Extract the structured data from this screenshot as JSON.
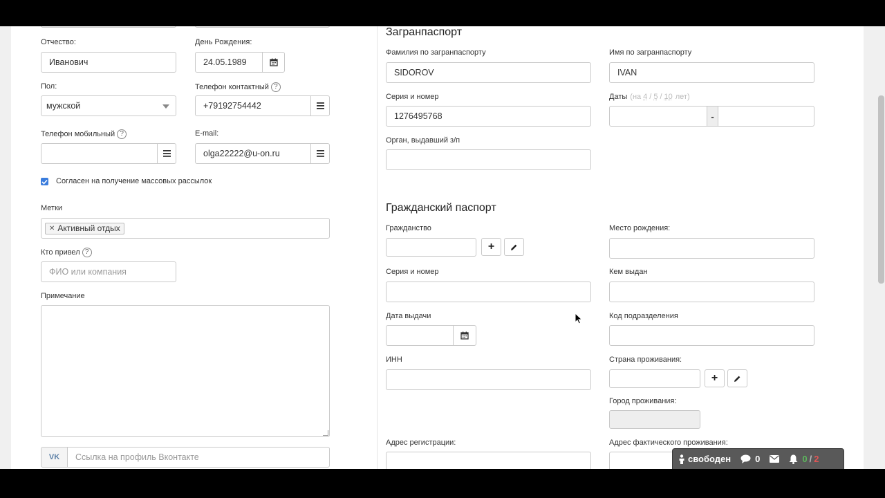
{
  "left": {
    "patronymic": {
      "label": "Отчество:",
      "value": "Иванович"
    },
    "birthday": {
      "label": "День Рождения:",
      "value": "24.05.1989"
    },
    "gender": {
      "label": "Пол:",
      "value": "мужской"
    },
    "phone_contact": {
      "label": "Телефон контактный",
      "value": "+79192754442"
    },
    "phone_mobile": {
      "label": "Телефон мобильный",
      "value": ""
    },
    "email": {
      "label": "E-mail:",
      "value": "olga22222@u-on.ru"
    },
    "mailing_consent": {
      "label": "Согласен на получение массовых рассылок",
      "checked": true
    },
    "tags": {
      "label": "Метки",
      "items": [
        "Активный отдых"
      ]
    },
    "referrer": {
      "label": "Кто привел",
      "placeholder": "ФИО или компания"
    },
    "note": {
      "label": "Примечание",
      "value": ""
    },
    "vk": {
      "icon_text": "VK",
      "placeholder": "Ссылка на профиль Вконтакте"
    },
    "help_glyph": "?"
  },
  "foreign_passport": {
    "title": "Загранпаспорт",
    "surname": {
      "label": "Фамилия по загранпаспорту",
      "value": "SIDOROV"
    },
    "name": {
      "label": "Имя по загранпаспорту",
      "value": "IVAN"
    },
    "series_number": {
      "label": "Серия и номер",
      "value": "1276495768"
    },
    "dates": {
      "label": "Даты",
      "hint_prefix": "(на",
      "hint_options": [
        "4",
        "5",
        "10"
      ],
      "hint_sep": "/",
      "hint_suffix": "лет)",
      "separator": "-"
    },
    "issuer": {
      "label": "Орган, выдавший з/п",
      "value": ""
    }
  },
  "civil_passport": {
    "title": "Гражданский паспорт",
    "citizenship": {
      "label": "Гражданство",
      "value": ""
    },
    "birth_place": {
      "label": "Место рождения:",
      "value": ""
    },
    "series_number": {
      "label": "Серия и номер",
      "value": ""
    },
    "issued_by": {
      "label": "Кем выдан",
      "value": ""
    },
    "issue_date": {
      "label": "Дата выдачи",
      "value": ""
    },
    "division_code": {
      "label": "Код подразделения",
      "value": ""
    },
    "inn": {
      "label": "ИНН",
      "value": ""
    },
    "country": {
      "label": "Страна проживания:",
      "value": ""
    },
    "city": {
      "label": "Город проживания:",
      "value": ""
    },
    "reg_address": {
      "label": "Адрес регистрации:"
    },
    "actual_address": {
      "label": "Адрес фактического проживания:"
    },
    "plus_glyph": "+"
  },
  "status_bar": {
    "status": "свободен",
    "messages": "0",
    "notif_done": "0",
    "notif_sep": "/",
    "notif_total": "2"
  },
  "colors": {
    "accent_check": "#3b7ddd",
    "green": "#5cb85c",
    "red": "#e05555"
  }
}
